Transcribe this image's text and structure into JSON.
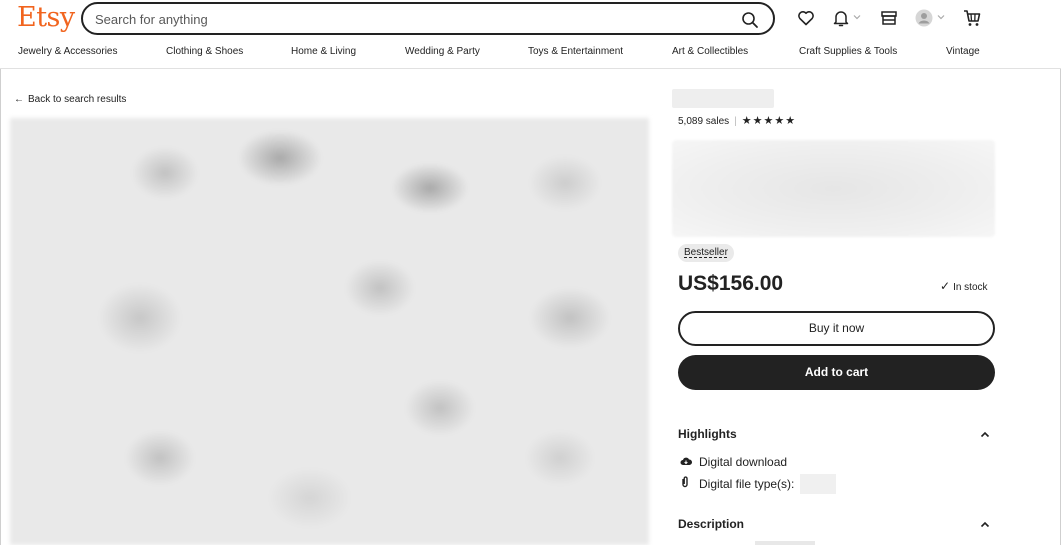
{
  "header": {
    "logo": "Etsy",
    "search_placeholder": "Search for anything",
    "icons": [
      "search-icon",
      "heart-icon",
      "bell-icon",
      "shop-icon",
      "account-icon",
      "cart-icon"
    ]
  },
  "nav": {
    "categories": [
      "Jewelry & Accessories",
      "Clothing & Shoes",
      "Home & Living",
      "Wedding & Party",
      "Toys & Entertainment",
      "Art & Collectibles",
      "Craft Supplies & Tools",
      "Vintage"
    ]
  },
  "back_link": "Back to search results",
  "listing": {
    "sales": "5,089 sales",
    "rating_stars": 5,
    "stars_text": "★★★★★",
    "badge": "Bestseller",
    "price": "US$156.00",
    "stock": "In stock",
    "buy_now_label": "Buy it now",
    "add_to_cart_label": "Add to cart"
  },
  "highlights": {
    "title": "Highlights",
    "items": [
      {
        "icon": "cloud-download-icon",
        "text": "Digital download"
      },
      {
        "icon": "paperclip-icon",
        "text": "Digital file type(s):"
      }
    ]
  },
  "description": {
    "title": "Description"
  },
  "colors": {
    "brand": "#f1641e",
    "dark": "#222222"
  }
}
